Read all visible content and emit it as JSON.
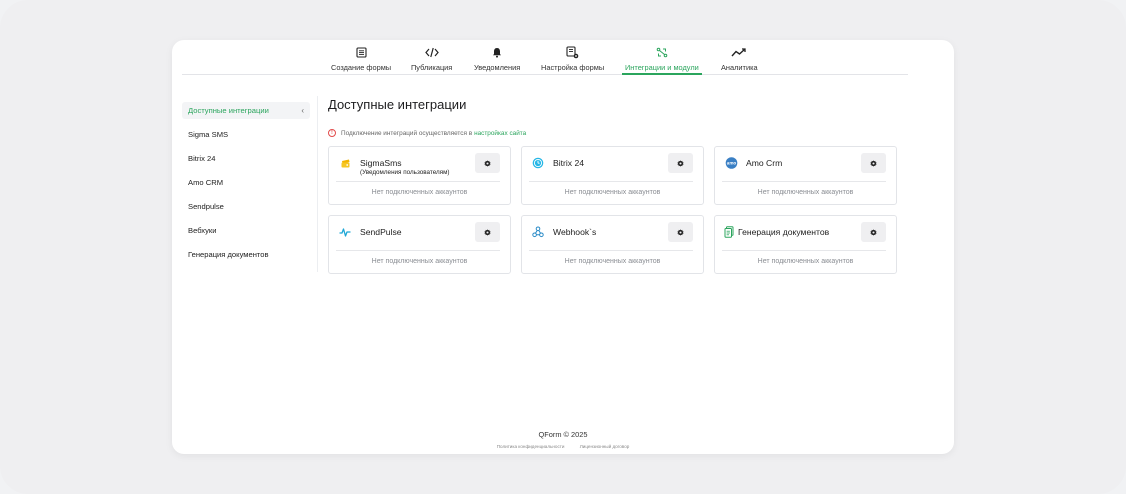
{
  "nav": {
    "tabs": [
      {
        "label": "Создание формы",
        "icon": "form-icon"
      },
      {
        "label": "Публикация",
        "icon": "code-icon"
      },
      {
        "label": "Уведомления",
        "icon": "bell-icon"
      },
      {
        "label": "Настройка формы",
        "icon": "form-settings-icon"
      },
      {
        "label": "Интеграции и модули",
        "icon": "integrations-icon",
        "active": true
      },
      {
        "label": "Аналитика",
        "icon": "analytics-icon"
      }
    ],
    "accent": "#2ba55d"
  },
  "sidebar": {
    "items": [
      {
        "label": "Доступные интеграции",
        "active": true
      },
      {
        "label": "Sigma SMS"
      },
      {
        "label": "Bitrix 24"
      },
      {
        "label": "Amo CRM"
      },
      {
        "label": "Sendpulse"
      },
      {
        "label": "Вебхуки"
      },
      {
        "label": "Генерация документов"
      }
    ],
    "collapse_glyph": "‹"
  },
  "main": {
    "title": "Доступные интеграции",
    "notice": {
      "text": "Подключение интеграций осуществляется в",
      "link": "настройках сайта",
      "icon": "warning-icon"
    },
    "cards": [
      {
        "name": "SigmaSms",
        "sub": "(Уведомления пользователям)",
        "icon": "sigmasms-logo-icon",
        "empty": "Нет подключенных аккаунтов"
      },
      {
        "name": "Bitrix 24",
        "icon": "bitrix24-logo-icon",
        "empty": "Нет подключенных аккаунтов"
      },
      {
        "name": "Amo Crm",
        "icon": "amocrm-logo-icon",
        "logo_text": "amo",
        "empty": "Нет подключенных аккаунтов"
      },
      {
        "name": "SendPulse",
        "icon": "sendpulse-logo-icon",
        "empty": "Нет подключенных аккаунтов"
      },
      {
        "name": "Webhook`s",
        "icon": "webhook-icon",
        "empty": "Нет подключенных аккаунтов"
      },
      {
        "name": "Генерация документов",
        "icon": "document-generation-icon",
        "empty": "Нет подключенных аккаунтов"
      }
    ]
  },
  "footer": {
    "copyright": "QForm © 2025",
    "links": [
      "Политика конфиденциальности",
      "Лицензионный договор"
    ]
  }
}
